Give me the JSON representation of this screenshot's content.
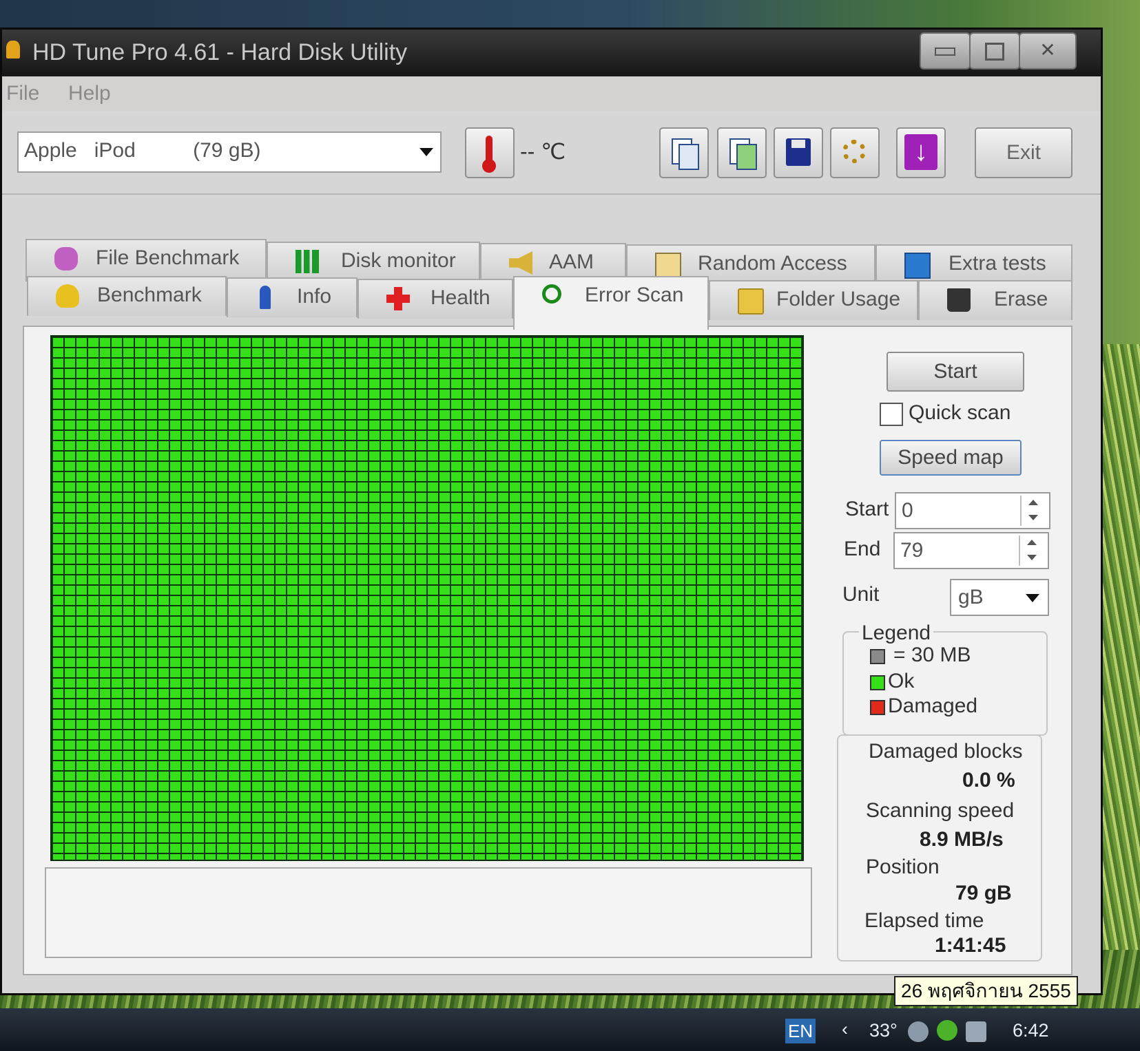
{
  "window": {
    "title": "HD Tune Pro 4.61 - Hard Disk Utility"
  },
  "menu": {
    "file": "File",
    "help": "Help"
  },
  "toolbar": {
    "drive": "Apple   iPod          (79 gB)",
    "temperature": "-- ℃",
    "exit_label": "Exit"
  },
  "tabs": {
    "row1": [
      "File Benchmark",
      "Disk monitor",
      "AAM",
      "Random Access",
      "Extra tests"
    ],
    "row2": [
      "Benchmark",
      "Info",
      "Health",
      "Error Scan",
      "Folder Usage",
      "Erase"
    ],
    "active": "Error Scan"
  },
  "error_scan": {
    "start_button": "Start",
    "quick_scan_label": "Quick scan",
    "quick_scan_checked": false,
    "speed_map_button": "Speed map",
    "start_label": "Start",
    "start_value": "0",
    "end_label": "End",
    "end_value": "79",
    "unit_label": "Unit",
    "unit_value": "gB",
    "legend": {
      "title": "Legend",
      "block_size": "= 30 MB",
      "ok": "Ok",
      "damaged": "Damaged",
      "block_color": "#8a8a8a",
      "ok_color": "#35e018",
      "damaged_color": "#e02a1a"
    },
    "stats": {
      "damaged_blocks_label": "Damaged blocks",
      "damaged_blocks_value": "0.0 %",
      "scanning_speed_label": "Scanning speed",
      "scanning_speed_value": "8.9 MB/s",
      "position_label": "Position",
      "position_value": "79 gB",
      "elapsed_time_label": "Elapsed time",
      "elapsed_time_value": "1:41:45"
    }
  },
  "taskbar": {
    "language": "EN",
    "temperature": "33°",
    "time": "6:42",
    "date_tooltip": "26 พฤศจิกายน 2555"
  }
}
